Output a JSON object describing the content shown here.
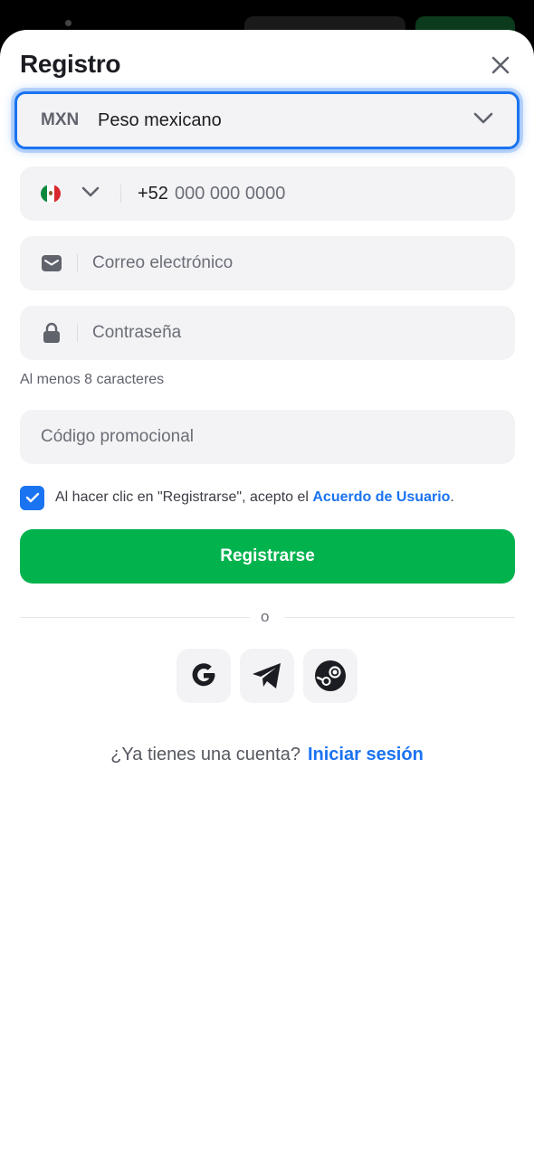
{
  "header": {
    "title": "Registro"
  },
  "currency": {
    "code": "MXN",
    "name": "Peso mexicano"
  },
  "phone": {
    "prefix": "+52",
    "placeholder": "000 000 0000"
  },
  "email": {
    "placeholder": "Correo electrónico"
  },
  "password": {
    "placeholder": "Contraseña",
    "hint": "Al menos 8 caracteres"
  },
  "promo": {
    "placeholder": "Código promocional"
  },
  "agreement": {
    "text": "Al hacer clic en \"Registrarse\", acepto el ",
    "link": "Acuerdo de Usuario",
    "suffix": ".",
    "checked": true
  },
  "register_button": "Registrarse",
  "divider": "o",
  "social": [
    "google-icon",
    "telegram-icon",
    "steam-icon"
  ],
  "login": {
    "question": "¿Ya tienes una cuenta?",
    "link": "Iniciar sesión"
  },
  "colors": {
    "accent": "#1a73f0",
    "primary_button": "#02b24d"
  }
}
